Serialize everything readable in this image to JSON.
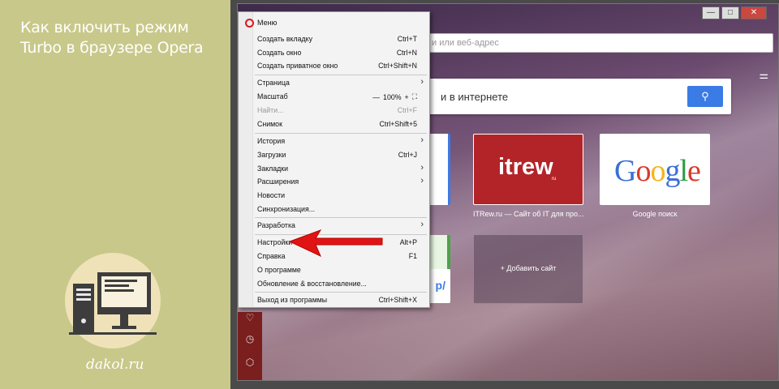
{
  "article": {
    "title": "Как включить режим Turbo в браузере Opera",
    "site": "dakol.ru"
  },
  "window": {
    "controls": [
      "—",
      "□",
      "✕"
    ]
  },
  "address_bar": {
    "placeholder": "и или веб-адрес"
  },
  "search": {
    "placeholder": "и в интернете"
  },
  "speed_dial": {
    "itrew_title": "itrew",
    "itrew_sub": "ru",
    "itrew_caption": "ITRew.ru — Сайт об IT для про...",
    "google_caption": "Google поиск",
    "add_caption": "+ Добавить сайт",
    "partial_label": "p/"
  },
  "google_letters": [
    {
      "ch": "G",
      "color": "#3b6fd6"
    },
    {
      "ch": "o",
      "color": "#d93a2b"
    },
    {
      "ch": "o",
      "color": "#f2b51e"
    },
    {
      "ch": "g",
      "color": "#3b6fd6"
    },
    {
      "ch": "l",
      "color": "#2d9a47"
    },
    {
      "ch": "e",
      "color": "#d93a2b"
    }
  ],
  "menu": {
    "title": "Меню",
    "items": [
      {
        "label": "Создать вкладку",
        "shortcut": "Ctrl+T"
      },
      {
        "label": "Создать окно",
        "shortcut": "Ctrl+N"
      },
      {
        "label": "Создать приватное окно",
        "shortcut": "Ctrl+Shift+N"
      },
      {
        "label": "Страница",
        "shortcut": ""
      },
      {
        "label": "Масштаб",
        "shortcut": ""
      },
      {
        "label": "Найти...",
        "shortcut": "Ctrl+F"
      },
      {
        "label": "Снимок",
        "shortcut": "Ctrl+Shift+5"
      },
      {
        "label": "История",
        "shortcut": ""
      },
      {
        "label": "Загрузки",
        "shortcut": "Ctrl+J"
      },
      {
        "label": "Закладки",
        "shortcut": ""
      },
      {
        "label": "Расширения",
        "shortcut": ""
      },
      {
        "label": "Новости",
        "shortcut": ""
      },
      {
        "label": "Синхронизация...",
        "shortcut": ""
      },
      {
        "label": "Разработка",
        "shortcut": ""
      },
      {
        "label": "Настройки",
        "shortcut": "Alt+P"
      },
      {
        "label": "Справка",
        "shortcut": "F1"
      },
      {
        "label": "О программе",
        "shortcut": ""
      },
      {
        "label": "Обновление & восстановление...",
        "shortcut": ""
      },
      {
        "label": "Выход из программы",
        "shortcut": "Ctrl+Shift+X"
      }
    ],
    "zoom": {
      "minus": "—",
      "value": "100%",
      "plus": "+"
    }
  },
  "colors": {
    "accent_red": "#e0141e",
    "search_blue": "#3a7be6",
    "arrow_red": "#e01414"
  }
}
